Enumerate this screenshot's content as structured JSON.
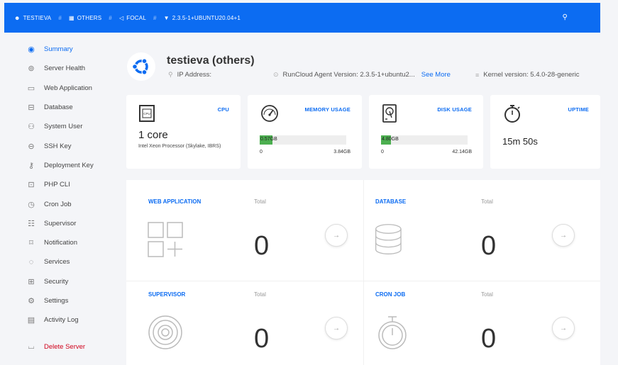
{
  "breadcrumbs": [
    {
      "icon": "user-icon",
      "glyph": "☻",
      "label": "TESTIEVA"
    },
    {
      "icon": "grid-icon",
      "glyph": "▦",
      "label": "OTHERS"
    },
    {
      "icon": "send-icon",
      "glyph": "◁",
      "label": "FOCAL"
    },
    {
      "icon": "wifi-icon",
      "glyph": "▼",
      "label": "2.3.5-1+UBUNTU20.04+1"
    }
  ],
  "topbar": {
    "right_icon": "location-pin-icon"
  },
  "sidebar": {
    "items": [
      {
        "label": "Summary",
        "icon": "summary-icon",
        "glyph": "◉"
      },
      {
        "label": "Server Health",
        "icon": "health-icon",
        "glyph": "⊚"
      },
      {
        "label": "Web Application",
        "icon": "web-app-icon",
        "glyph": "▭"
      },
      {
        "label": "Database",
        "icon": "database-icon",
        "glyph": "⊟"
      },
      {
        "label": "System User",
        "icon": "system-user-icon",
        "glyph": "⚇"
      },
      {
        "label": "SSH Key",
        "icon": "lock-icon",
        "glyph": "⊖"
      },
      {
        "label": "Deployment Key",
        "icon": "key-icon",
        "glyph": "⚷"
      },
      {
        "label": "PHP CLI",
        "icon": "terminal-icon",
        "glyph": "⊡"
      },
      {
        "label": "Cron Job",
        "icon": "clock-icon",
        "glyph": "◷"
      },
      {
        "label": "Supervisor",
        "icon": "supervisor-icon",
        "glyph": "☷"
      },
      {
        "label": "Notification",
        "icon": "notification-icon",
        "glyph": "⌑"
      },
      {
        "label": "Services",
        "icon": "services-icon",
        "glyph": "◌"
      },
      {
        "label": "Security",
        "icon": "security-icon",
        "glyph": "⊞"
      },
      {
        "label": "Settings",
        "icon": "settings-icon",
        "glyph": "⚙"
      },
      {
        "label": "Activity Log",
        "icon": "activity-log-icon",
        "glyph": "▤"
      }
    ],
    "delete_label": "Delete Server"
  },
  "server": {
    "title": "testieva (others)",
    "ip_label": "IP Address:",
    "agent_text": "RunCloud Agent Version: 2.3.5-1+ubuntu2...",
    "agent_link": "See More",
    "kernel_text": "Kernel version: 5.4.0-28-generic"
  },
  "cards": {
    "cpu": {
      "title": "CPU",
      "value": "1 core",
      "desc": "Intel Xeon Processor (Skylake, IBRS)"
    },
    "memory": {
      "title": "MEMORY USAGE",
      "used": "0.57GB",
      "min": "0",
      "max": "3.84GB",
      "fraction": 0.148
    },
    "disk": {
      "title": "DISK USAGE",
      "used": "4.80GB",
      "min": "0",
      "max": "42.14GB",
      "fraction": 0.114
    },
    "uptime": {
      "title": "UPTIME",
      "value": "15m 50s"
    }
  },
  "panels": {
    "web_app": {
      "title": "WEB APPLICATION",
      "total_label": "Total",
      "count": "0"
    },
    "database": {
      "title": "DATABASE",
      "total_label": "Total",
      "count": "0"
    },
    "supervisor": {
      "title": "SUPERVISOR",
      "total_label": "Total",
      "count": "0"
    },
    "cron": {
      "title": "CRON JOB",
      "total_label": "Total",
      "count": "0"
    }
  },
  "colors": {
    "accent": "#0c6cf2",
    "success": "#4caf50",
    "danger": "#d0021b"
  }
}
